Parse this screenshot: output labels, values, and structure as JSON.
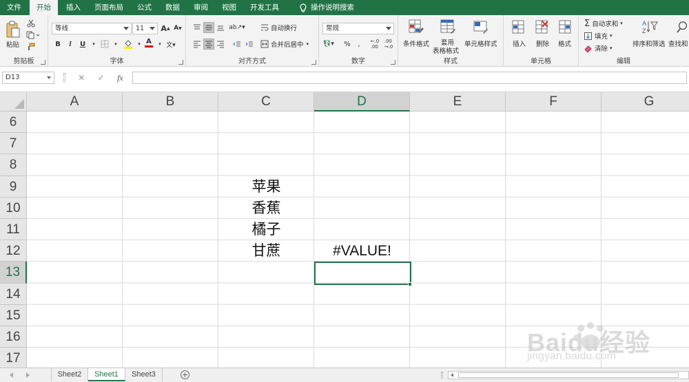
{
  "menu": {
    "items": [
      "文件",
      "开始",
      "插入",
      "页面布局",
      "公式",
      "数据",
      "审阅",
      "视图",
      "开发工具"
    ],
    "active_index": 1,
    "tell_me": "操作说明搜索"
  },
  "ribbon": {
    "clipboard": {
      "paste": "粘贴",
      "label": "剪贴板"
    },
    "font": {
      "name": "等线",
      "size": "11",
      "label": "字体",
      "bold": "B",
      "italic": "I",
      "underline": "U"
    },
    "alignment": {
      "wrap": "自动换行",
      "merge": "合并后居中",
      "label": "对齐方式"
    },
    "number": {
      "format": "常规",
      "label": "数字"
    },
    "styles": {
      "conditional": "条件格式",
      "table1": "套用",
      "table2": "表格格式",
      "cell": "单元格样式",
      "label": "样式"
    },
    "cells": {
      "insert": "插入",
      "delete": "删除",
      "format": "格式",
      "label": "单元格"
    },
    "editing": {
      "autosum": "自动求和",
      "fill": "填充",
      "clear": "清除",
      "sort": "排序和筛选",
      "find": "查找和",
      "label": "编辑"
    }
  },
  "formula_bar": {
    "name_box": "D13",
    "formula": ""
  },
  "grid": {
    "columns": [
      "A",
      "B",
      "C",
      "D",
      "E",
      "F",
      "G"
    ],
    "selected_column": "D",
    "rows": [
      "6",
      "7",
      "8",
      "9",
      "10",
      "11",
      "12",
      "13",
      "14",
      "15",
      "16",
      "17"
    ],
    "selected_row": "13",
    "cells": [
      {
        "ref": "C9",
        "value": "苹果"
      },
      {
        "ref": "C10",
        "value": "香蕉"
      },
      {
        "ref": "C11",
        "value": "橘子"
      },
      {
        "ref": "C12",
        "value": "甘蔗"
      },
      {
        "ref": "D12",
        "value": "#VALUE!"
      }
    ]
  },
  "sheets": {
    "tabs": [
      "Sheet2",
      "Sheet1",
      "Sheet3"
    ],
    "active": "Sheet1"
  },
  "watermark": {
    "logo": "Baidu经验",
    "url": "jingyan.baidu.com"
  },
  "colors": {
    "accent": "#217346"
  }
}
